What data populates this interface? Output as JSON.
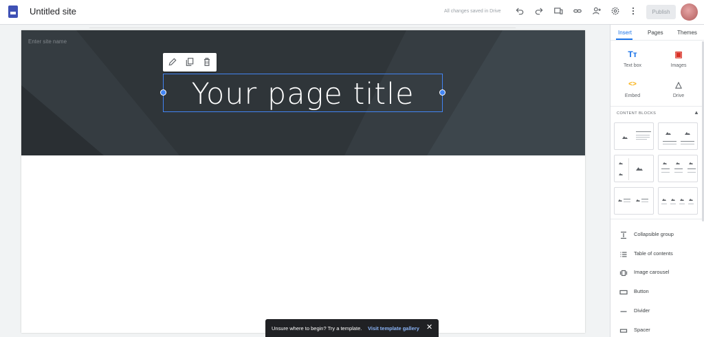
{
  "app": {
    "title": "Untitled site",
    "saved_status": "All changes saved in Drive",
    "publish_label": "Publish"
  },
  "toolbar": {
    "icons": [
      "undo-icon",
      "redo-icon",
      "preview-icon",
      "link-icon",
      "share-icon",
      "settings-icon",
      "more-icon"
    ]
  },
  "editor": {
    "site_name_placeholder": "Enter site name",
    "page_title": "Your page title",
    "edit_icons": [
      "pencil-icon",
      "duplicate-icon",
      "trash-icon"
    ]
  },
  "sidebar": {
    "tabs": [
      "Insert",
      "Pages",
      "Themes"
    ],
    "insert_items": [
      {
        "label": "Text box",
        "icon": "text-box-icon",
        "glyph": "Tт"
      },
      {
        "label": "Images",
        "icon": "image-icon",
        "glyph": "▣"
      },
      {
        "label": "Embed",
        "icon": "embed-icon",
        "glyph": "<>"
      },
      {
        "label": "Drive",
        "icon": "drive-icon",
        "glyph": "△"
      }
    ],
    "content_blocks_label": "CONTENT BLOCKS",
    "list_items": [
      {
        "label": "Collapsible group",
        "icon": "collapsible-group-icon"
      },
      {
        "label": "Table of contents",
        "icon": "table-of-contents-icon"
      },
      {
        "label": "Image carousel",
        "icon": "image-carousel-icon"
      },
      {
        "label": "Button",
        "icon": "button-icon"
      },
      {
        "label": "Divider",
        "icon": "divider-icon"
      },
      {
        "label": "Spacer",
        "icon": "spacer-icon"
      }
    ]
  },
  "snackbar": {
    "message": "Unsure where to begin? Try a template.",
    "link": "Visit template gallery"
  },
  "colors": {
    "accent": "#1a73e8",
    "header_bg": "#2f3539",
    "selection": "#4285f4",
    "images_icon": "#d93025",
    "embed_icon": "#f9ab00"
  }
}
